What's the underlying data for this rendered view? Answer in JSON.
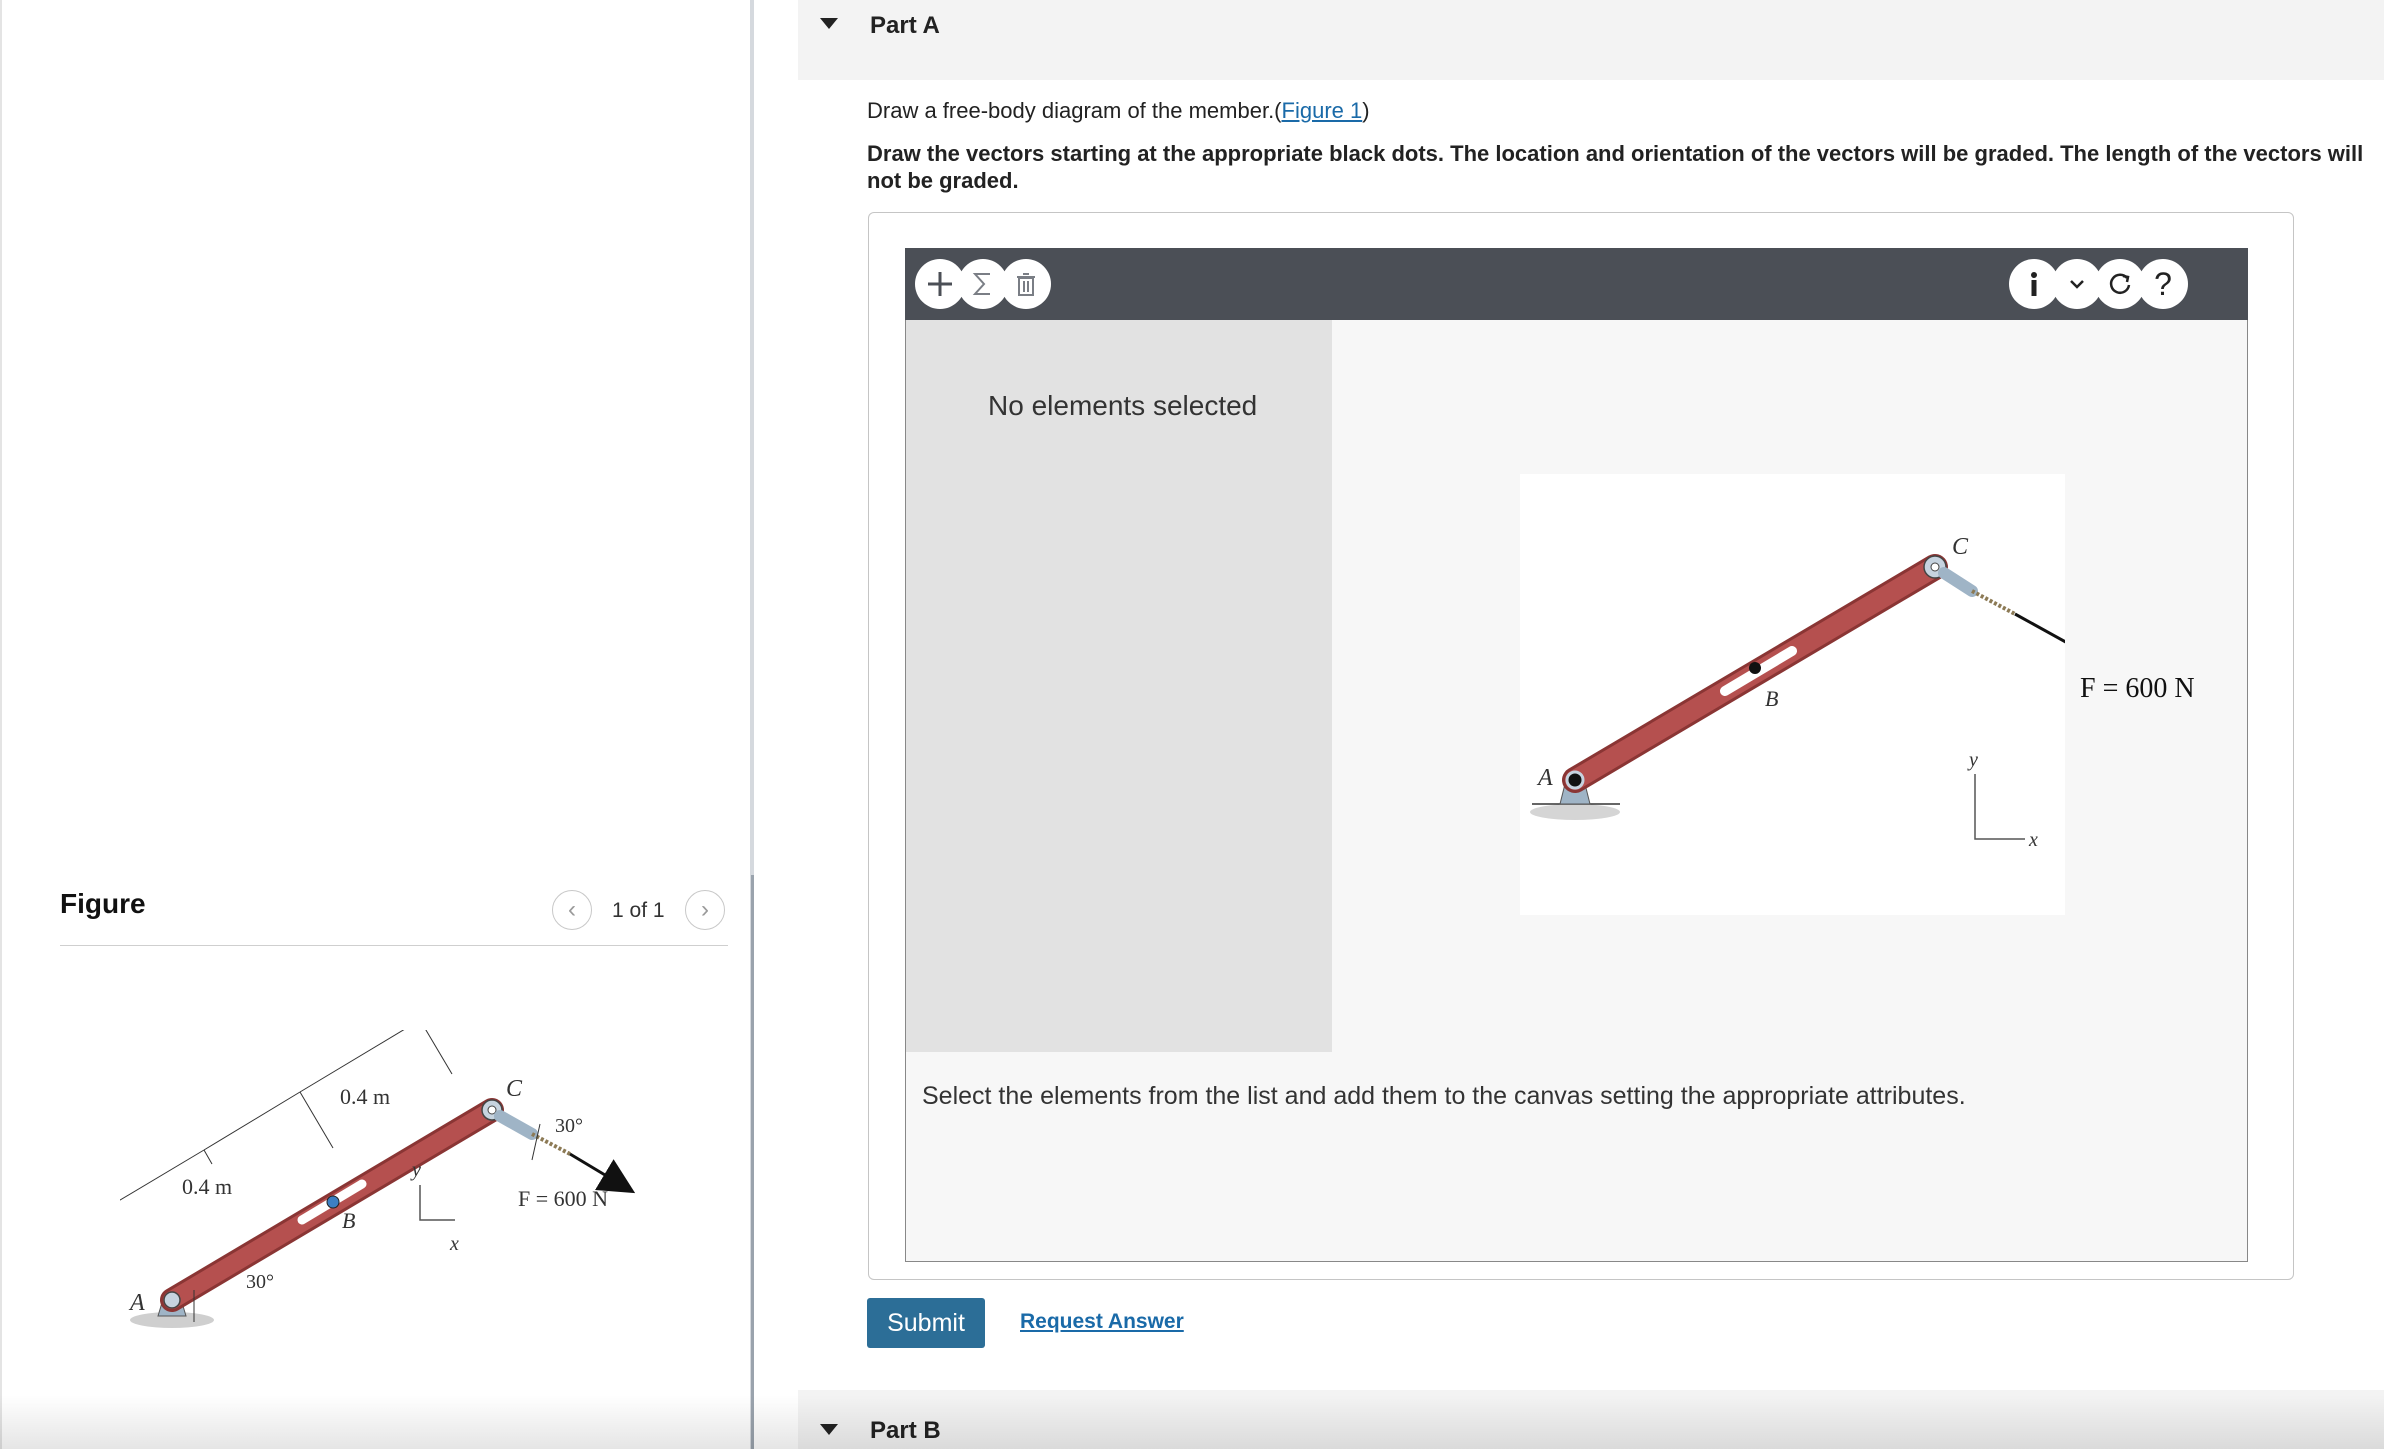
{
  "figure_panel": {
    "heading": "Figure",
    "pager": "1 of 1",
    "prev_icon": "chevron-left-icon",
    "next_icon": "chevron-right-icon",
    "diagram_labels": {
      "point_a": "A",
      "point_b": "B",
      "point_c": "C",
      "dim_1": "0.4 m",
      "dim_2": "0.4 m",
      "angle_member": "30°",
      "angle_force": "30°",
      "force": "F = 600 N",
      "axis_y": "y",
      "axis_x": "x"
    }
  },
  "part_a": {
    "title": "Part A",
    "instruction_prefix": "Draw a free-body diagram of the member.(",
    "figure_link": "Figure 1",
    "instruction_suffix": ")",
    "instruction_bold": "Draw the vectors starting at the appropriate black dots. The location and orientation of the vectors will be graded. The length of the vectors will not be graded.",
    "toolbar": {
      "left": [
        "add-icon",
        "sum-icon",
        "trash-icon"
      ],
      "right": [
        "info-icon",
        "chevron-down-icon",
        "reset-icon",
        "help-icon"
      ],
      "help_symbol": "?"
    },
    "no_elements": "No elements selected",
    "canvas_labels": {
      "point_a": "A",
      "point_b": "B",
      "point_c": "C",
      "force": "F = 600 N",
      "axis_y": "y",
      "axis_x": "x"
    },
    "status": "Select the elements from the list and add them to the canvas setting the appropriate attributes.",
    "submit": "Submit",
    "request_answer": "Request Answer"
  },
  "part_b": {
    "title": "Part B"
  },
  "colors": {
    "member": "#b5504f",
    "toolbar": "#4b4f56",
    "submit": "#2c6e97",
    "link": "#1a6aa8"
  }
}
